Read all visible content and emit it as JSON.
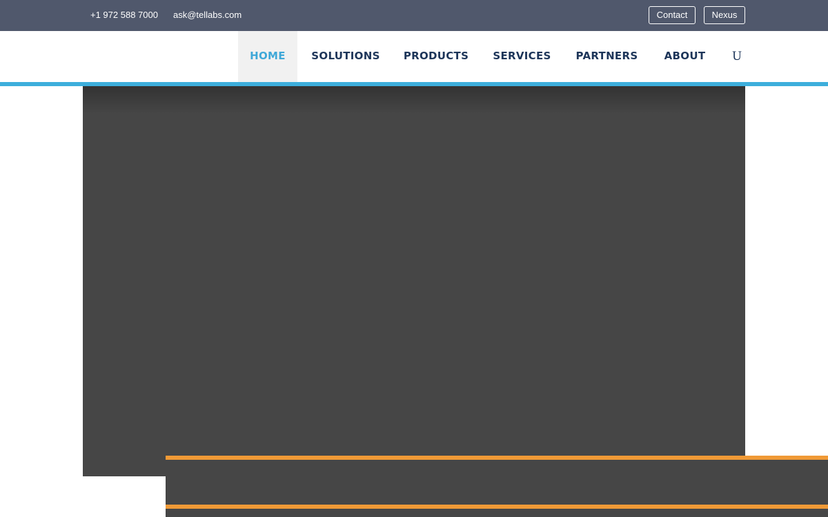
{
  "topbar": {
    "phone": "+1 972 588 7000",
    "email": "ask@tellabs.com",
    "buttons": {
      "contact": "Contact",
      "nexus": "Nexus"
    }
  },
  "nav": {
    "items": [
      {
        "label": "HOME",
        "active": true
      },
      {
        "label": "SOLUTIONS",
        "active": false
      },
      {
        "label": "PRODUCTS",
        "active": false
      },
      {
        "label": "SERVICES",
        "active": false
      },
      {
        "label": "PARTNERS",
        "active": false
      },
      {
        "label": "ABOUT",
        "active": false
      }
    ],
    "search_glyph": "U",
    "search_icon": "search-icon"
  },
  "colors": {
    "topbar_bg": "#50586c",
    "nav_text": "#1d3559",
    "nav_active": "#3fa8d8",
    "nav_accent_line": "#3daedc",
    "hero_bg": "#464646",
    "band_accent": "#f09a36"
  }
}
